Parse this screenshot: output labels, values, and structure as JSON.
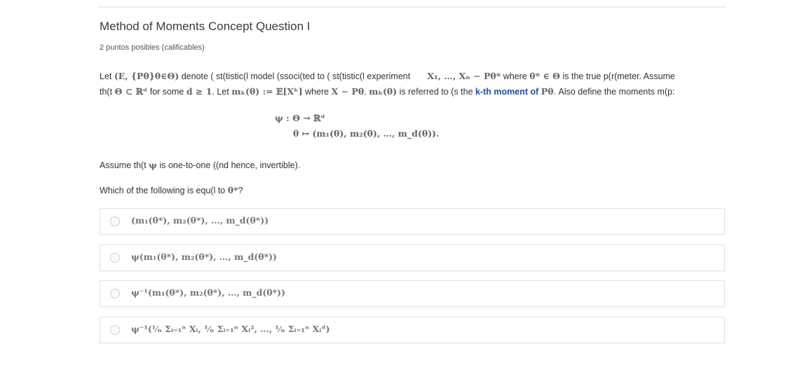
{
  "question": {
    "title": "Method of Moments Concept Question I",
    "points": "2 puntos posibles (calificables)",
    "para1": {
      "let": "Let",
      "m_model": "(E, {Pθ}θ∈Θ)",
      "t_denote": "denote ( st(tistic(l model (ssoci(ted to ( st(tistic(l experiment",
      "m_sample": "X₁, …, Xₙ ∼ Pθ*",
      "t_where": "where",
      "m_true": "θ* ∈ Θ",
      "t_true": "is the true p(r(meter. Assume"
    },
    "para2": {
      "t_that": "th(t",
      "m_subset": "Θ ⊂ ℝᵈ",
      "t_forsome": "for some",
      "m_d": "d ≥ 1",
      "t_let": ". Let",
      "m_moment": "mₖ(θ) := 𝔼[Xᵏ]",
      "t_where": "where",
      "m_xdist": "X ∼ Pθ",
      "t_dot": ".",
      "m_mk": "mₖ(θ)",
      "t_referred": "is referred to (s the",
      "link_kth": "k-th moment of",
      "m_ptheta": "Pθ",
      "t_define": ". Also define the moments m(p:"
    },
    "display": {
      "line1": "ψ : Θ → ℝᵈ",
      "line2": "θ ↦ (m₁(θ), m₂(θ), …, m_d(θ))."
    },
    "assume": {
      "t_pre": "Assume th(t",
      "m_psi": "ψ",
      "t_post": "is one-to-one ((nd hence, invertible)."
    },
    "which": {
      "t_pre": "Which of the following is equ(l to",
      "m_theta": "θ*",
      "t_post": "?"
    },
    "options": [
      {
        "math": "(m₁(θ*), m₂(θ*), …, m_d(θ*))"
      },
      {
        "math": "ψ(m₁(θ*), m₂(θ*), …, m_d(θ*))"
      },
      {
        "math": "ψ⁻¹(m₁(θ*), m₂(θ*), …, m_d(θ*))"
      },
      {
        "math": "ψ⁻¹(¹⁄ₙ Σᵢ₌₁ⁿ Xᵢ, ¹⁄ₙ Σᵢ₌₁ⁿ Xᵢ², …, ¹⁄ₙ Σᵢ₌₁ⁿ Xᵢᵈ)"
      }
    ]
  }
}
